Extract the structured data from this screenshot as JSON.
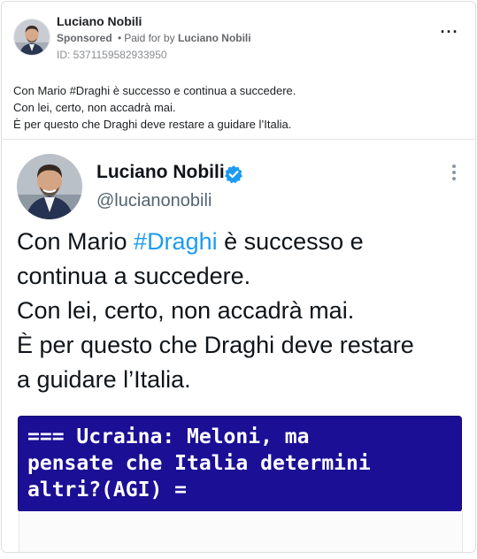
{
  "ad": {
    "advertiser_name": "Luciano Nobili",
    "sponsored_label": "Sponsored",
    "separator": "•",
    "paid_for_label": "Paid for by",
    "paid_for_name": "Luciano Nobili",
    "id_text": "ID: 5371159582933950",
    "more_icon": "more-horizontal-icon",
    "body_lines": [
      "Con Mario #Draghi è successo e continua a succedere.",
      "Con lei, certo, non accadrà mai.",
      "È per questo che Draghi deve restare a guidare l’Italia."
    ]
  },
  "tweet": {
    "display_name": "Luciano Nobili",
    "handle": "@lucianonobili",
    "verified_icon": "verified-badge-icon",
    "verified_color": "#1d9bf0",
    "more_icon": "more-vertical-icon",
    "line1_before": "Con Mario ",
    "hashtag": "#Draghi",
    "line1_after": " è successo e",
    "lines": [
      "continua a succedere.",
      "Con lei, certo, non accadrà mai.",
      "È per questo che Draghi deve restare",
      "a guidare l’Italia."
    ],
    "hashtag_color": "#1d9bf0"
  },
  "news_card": {
    "lines": [
      "=== Ucraina: Meloni, ma",
      "pensate che Italia determini",
      "altri?(AGI) ="
    ],
    "background_color": "#1b0f95"
  }
}
